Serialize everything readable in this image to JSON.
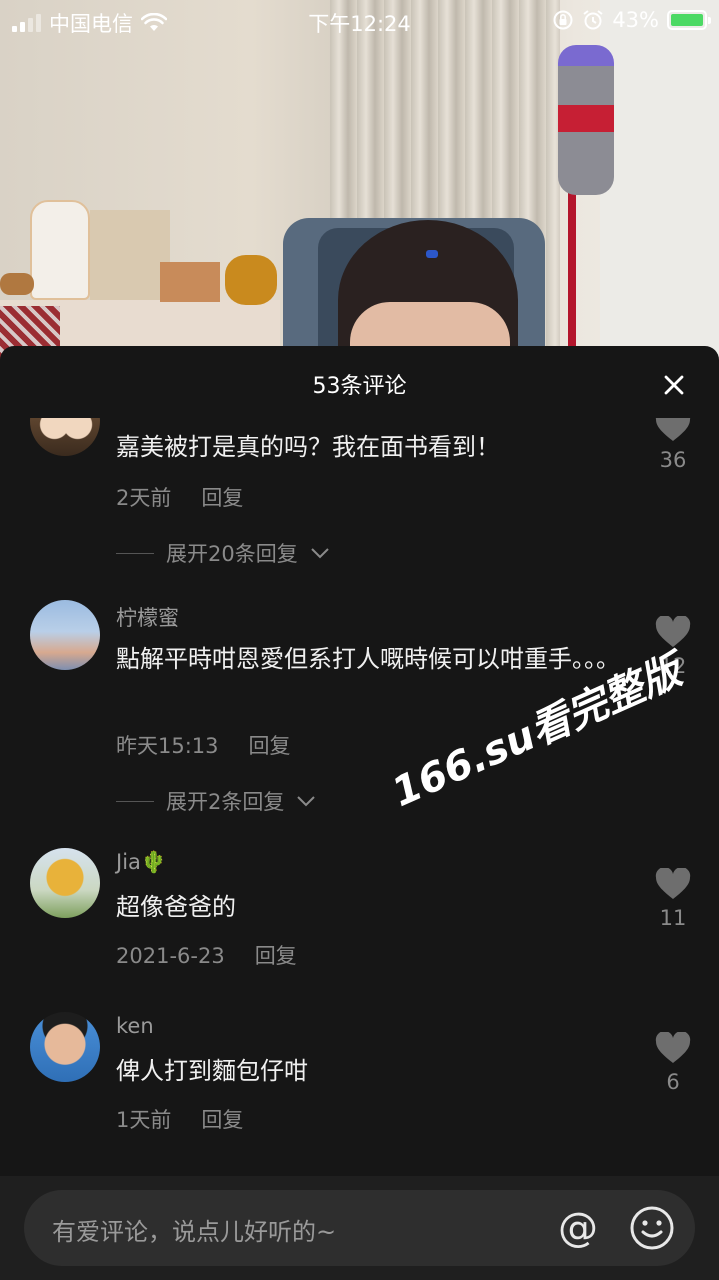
{
  "status_bar": {
    "carrier": "中国电信",
    "time": "下午12:24",
    "battery": "43%"
  },
  "sheet": {
    "title": "53条评论"
  },
  "comments": [
    {
      "username": "",
      "text": "嘉美被打是真的吗？我在面书看到！",
      "time": "2天前",
      "reply_label": "回复",
      "likes": "36",
      "expand_label": "展开20条回复"
    },
    {
      "username": "柠檬蜜",
      "text": "點解平時咁恩愛但系打人嘅時候可以咁重手。。。",
      "time": "昨天15:13",
      "reply_label": "回复",
      "likes": "12",
      "expand_label": "展开2条回复"
    },
    {
      "username": "Jia🌵",
      "text": "超像爸爸的",
      "time": "2021-6-23",
      "reply_label": "回复",
      "likes": "11"
    },
    {
      "username": "ken",
      "text": "俾人打到麵包仔咁",
      "time": "1天前",
      "reply_label": "回复",
      "likes": "6"
    }
  ],
  "watermark": "166.su看完整版",
  "input": {
    "placeholder": "有爱评论，说点儿好听的~",
    "at_symbol": "@"
  },
  "colors": {
    "sheet_background": "#161616",
    "input_background": "#2e2e2e",
    "battery": "#4cd964"
  }
}
